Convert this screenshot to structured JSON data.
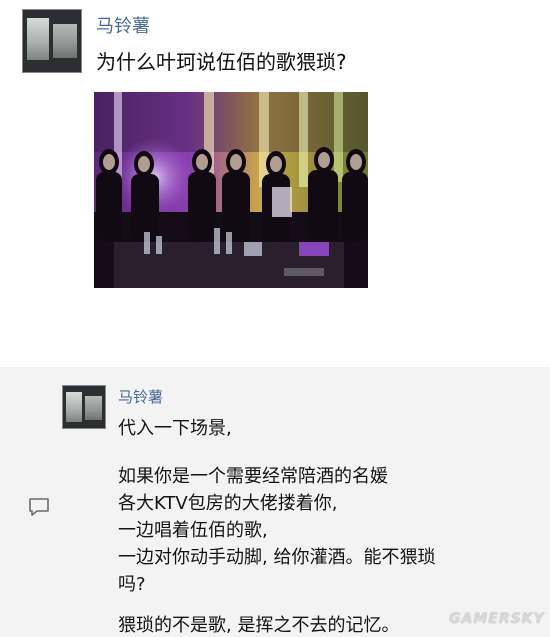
{
  "post": {
    "author": "马铃薯",
    "question": "为什么叶珂说伍佰的歌猥琐?"
  },
  "comment": {
    "author": "马铃薯",
    "lines": [
      "代入一下场景,",
      "如果你是一个需要经常陪酒的名媛",
      "各大KTV包房的大佬搂着你,",
      "一边唱着伍佰的歌,",
      "一边对你动手动脚, 给你灌酒。能不猥琐",
      "吗?",
      "猥琐的不是歌, 是挥之不去的记忆。"
    ]
  },
  "watermark": "GAMERSKY",
  "colors": {
    "author": "#4a6a95",
    "comment_bg": "#f3f3f3"
  }
}
